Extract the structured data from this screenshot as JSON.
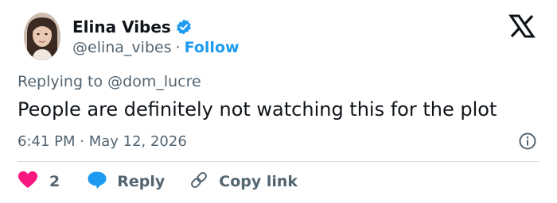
{
  "user": {
    "name": "Elina Vibes",
    "handle": "@elina_vibes",
    "separator": "·",
    "follow_label": "Follow"
  },
  "tweet": {
    "replying_prefix": "Replying to",
    "replying_to": "@dom_lucre",
    "text": "People are definitely not watching this for the plot",
    "timestamp": "6:41 PM · May 12, 2026"
  },
  "actions": {
    "like_count": "2",
    "reply_label": "Reply",
    "copy_link_label": "Copy link"
  },
  "colors": {
    "brand_blue": "#1d9bf0",
    "like_pink": "#f91880",
    "secondary_text": "#536471",
    "primary_text": "#0f1419"
  },
  "icons": [
    "avatar",
    "verified-badge-icon",
    "x-logo-icon",
    "info-icon",
    "heart-icon",
    "reply-bubble-icon",
    "link-icon"
  ]
}
